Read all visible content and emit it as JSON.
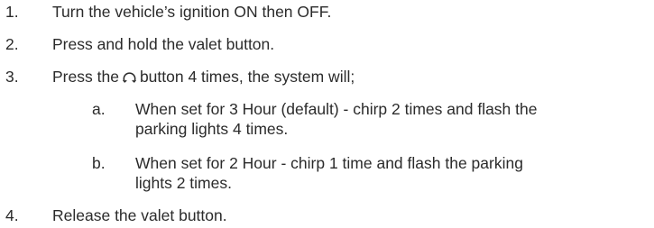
{
  "steps": [
    {
      "number": "1.",
      "text": "Turn the vehicle’s ignition ON then OFF."
    },
    {
      "number": "2.",
      "text": "Press and hold the valet button."
    },
    {
      "number": "3.",
      "text_before_icon": "Press the",
      "icon": "remote-button-icon",
      "text_after_icon": "button 4 times, the system will;",
      "substeps": [
        {
          "letter": "a.",
          "line1": "When set for 3 Hour (default) - chirp 2 times and flash the",
          "line2": "parking lights 4 times."
        },
        {
          "letter": "b.",
          "line1": "When set for 2 Hour - chirp 1 time and flash the parking",
          "line2": "lights 2 times."
        }
      ]
    },
    {
      "number": "4.",
      "text": "Release the valet button."
    }
  ]
}
